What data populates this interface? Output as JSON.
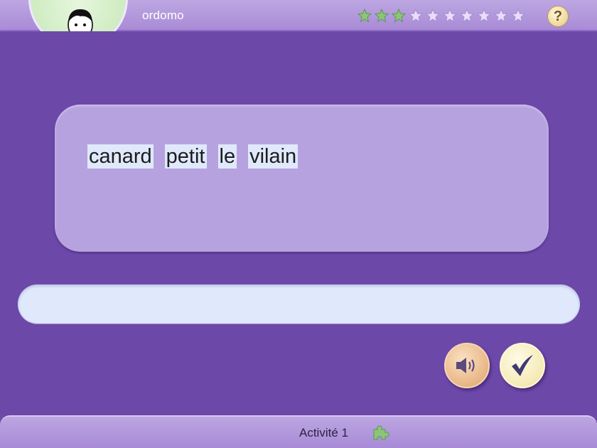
{
  "app": {
    "title": "ordomo"
  },
  "progress": {
    "stars_total": 10,
    "stars_earned": 3,
    "earned_color": "#8cc47a",
    "empty_color": "#e8ddfa"
  },
  "help": {
    "label": "?"
  },
  "exercise": {
    "words": [
      "canard",
      "petit",
      "le",
      "vilain"
    ],
    "answer": {
      "value": "",
      "placeholder": ""
    }
  },
  "controls": {
    "sound_icon": "speaker-icon",
    "validate_icon": "checkmark-icon"
  },
  "footer": {
    "activity_label": "Activité 1",
    "activity_icon": "puzzle-piece-icon"
  },
  "colors": {
    "panel": "#6c48a9",
    "bars": "#b8a2e0",
    "word_area": "#b7a2e0",
    "tile": "#dfe9fb"
  }
}
